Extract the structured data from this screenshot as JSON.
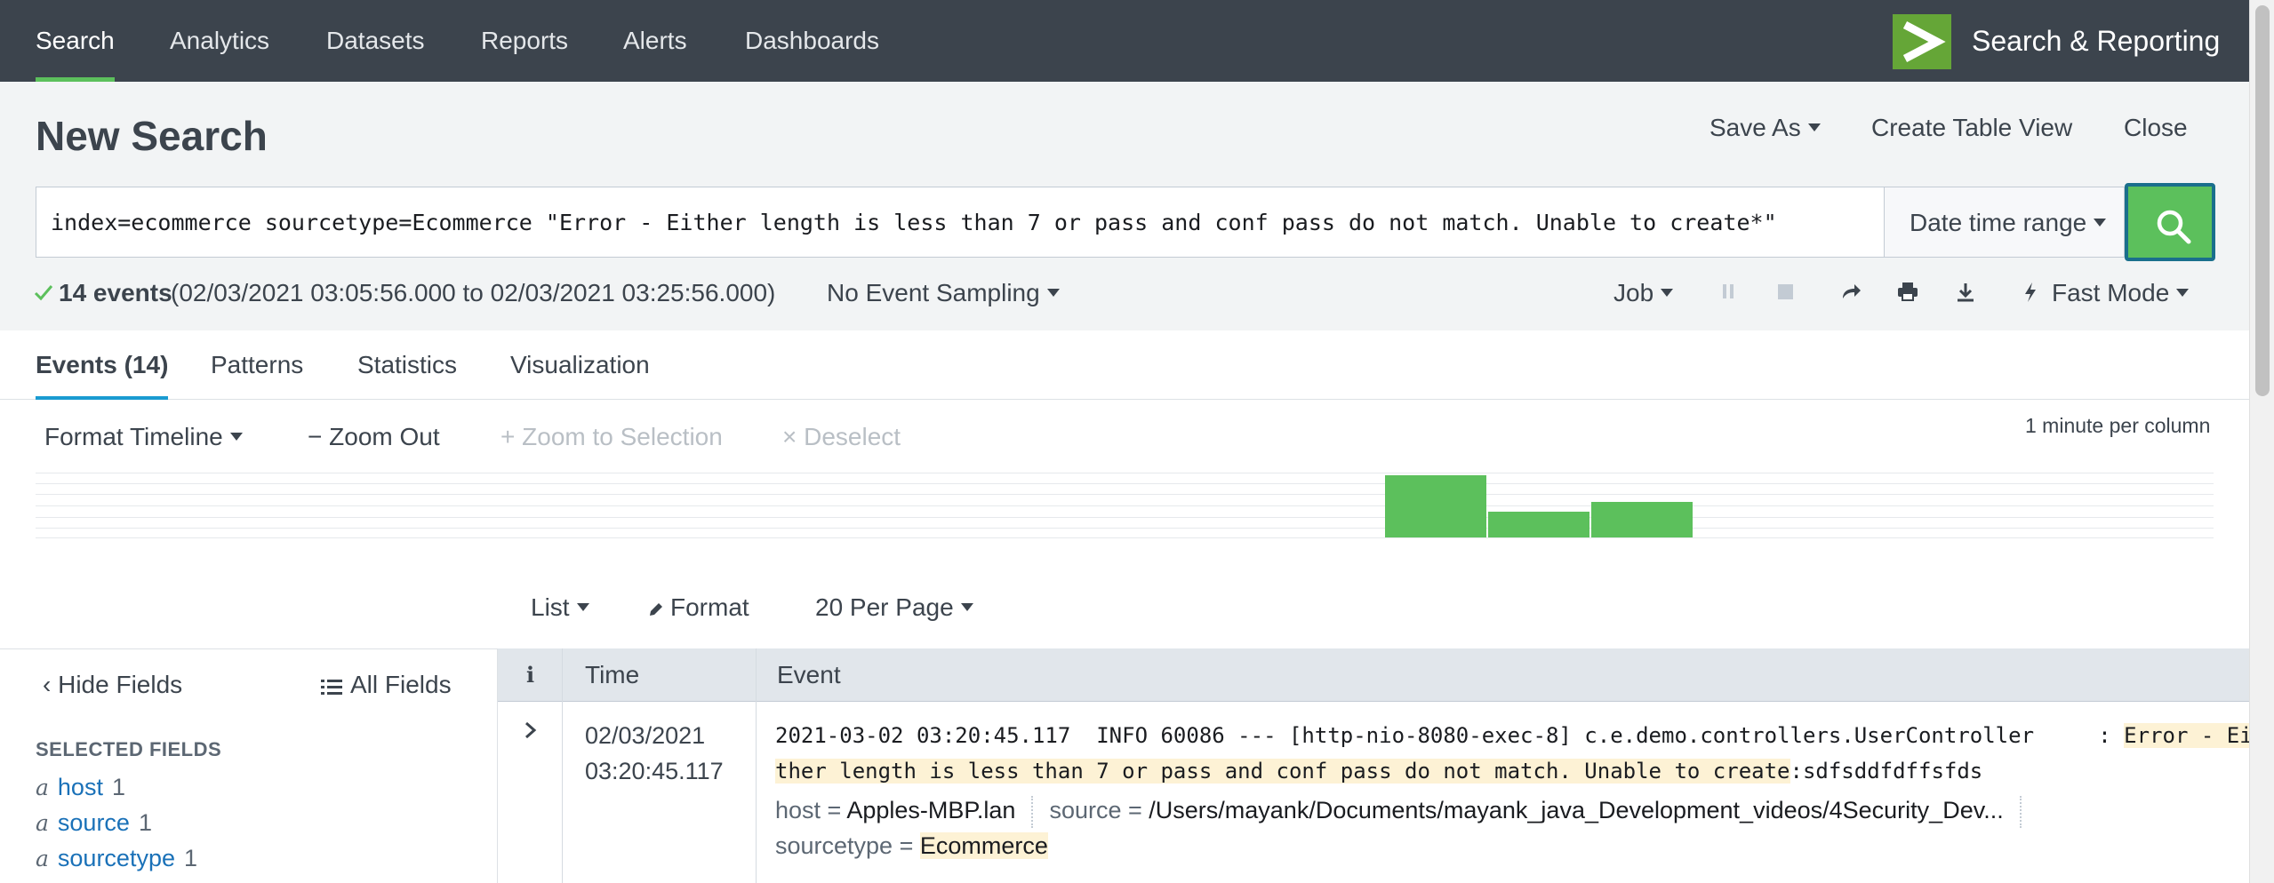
{
  "nav": {
    "items": [
      "Search",
      "Analytics",
      "Datasets",
      "Reports",
      "Alerts",
      "Dashboards"
    ],
    "app_name": "Search & Reporting"
  },
  "header": {
    "title": "New Search",
    "save_as": "Save As",
    "create_table_view": "Create Table View",
    "close": "Close"
  },
  "search": {
    "query": "index=ecommerce sourcetype=Ecommerce \"Error - Either length is less than 7 or pass and conf pass do not match. Unable to create*\"",
    "date_range": "Date time range"
  },
  "status": {
    "event_count": "14 events",
    "time_range": "(02/03/2021 03:05:56.000 to 02/03/2021 03:25:56.000)",
    "sampling": "No Event Sampling",
    "job": "Job",
    "mode": "Fast Mode"
  },
  "tabs": [
    "Events (14)",
    "Patterns",
    "Statistics",
    "Visualization"
  ],
  "timeline": {
    "format": "Format Timeline",
    "zoom_out": "Zoom Out",
    "zoom_selection": "Zoom to Selection",
    "deselect": "Deselect",
    "scale": "1 minute per column",
    "bar_levels": [
      1.0,
      0.42,
      0.57
    ]
  },
  "results_toolbar": {
    "list": "List",
    "format": "Format",
    "per_page": "20 Per Page"
  },
  "sidebar": {
    "hide_fields": "Hide Fields",
    "all_fields": "All Fields",
    "heading": "SELECTED FIELDS",
    "fields": [
      {
        "type": "a",
        "name": "host",
        "count": "1"
      },
      {
        "type": "a",
        "name": "source",
        "count": "1"
      },
      {
        "type": "a",
        "name": "sourcetype",
        "count": "1"
      }
    ]
  },
  "table": {
    "col_info": "i",
    "col_time": "Time",
    "col_event": "Event",
    "event": {
      "date": "02/03/2021",
      "time": "03:20:45.117",
      "line1_plain": "2021-03-02 03:20:45.117  INFO 60086 --- [http-nio-8080-exec-8] c.e.demo.controllers.UserController     : ",
      "line1_hl": "Error - Ei",
      "line2_hl": "ther length is less than 7 or pass and conf pass do not match. Unable to create",
      "line2_plain": ":sdfsddfdffsfds",
      "host_key": "host =",
      "host_val": "Apples-MBP.lan",
      "source_key": "source =",
      "source_val": "/Users/mayank/Documents/mayank_java_Development_videos/4Security_Dev...",
      "sourcetype_key": "sourcetype =",
      "sourcetype_val": "Ecommerce"
    }
  },
  "colors": {
    "nav_bg": "#3c444d",
    "accent_green": "#5cc05c",
    "link_blue": "#1a71b8",
    "highlight": "#fdf2d5"
  }
}
